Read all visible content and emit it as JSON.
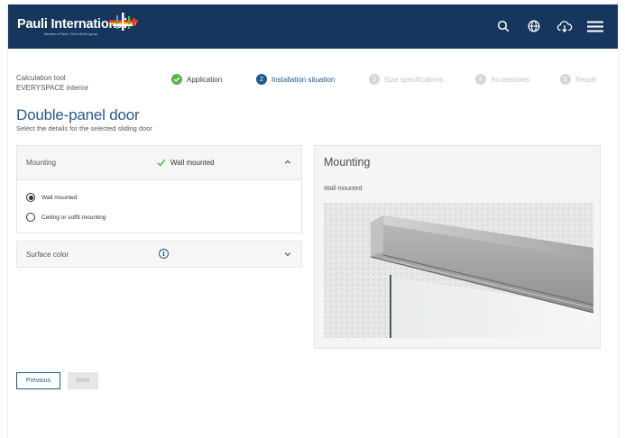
{
  "header": {
    "logo_text": "Pauli International",
    "logo_subtext": "Member of Pauli + Sohn GmbH group",
    "icons": [
      "search-icon",
      "globe-icon",
      "cloud-download-icon",
      "menu-icon"
    ]
  },
  "tool": {
    "line1": "Calculation tool",
    "line2": "EVERYSPACE interior"
  },
  "steps": [
    {
      "number": "",
      "label": "Application",
      "state": "done"
    },
    {
      "number": "2",
      "label": "Installation situation",
      "state": "active"
    },
    {
      "number": "3",
      "label": "Size specifications",
      "state": "todo"
    },
    {
      "number": "4",
      "label": "Accessories",
      "state": "todo"
    },
    {
      "number": "5",
      "label": "Result",
      "state": "todo"
    }
  ],
  "page": {
    "title": "Double-panel door",
    "subtitle": "Select the details for the selected sliding door"
  },
  "mounting": {
    "label": "Mounting",
    "selected_value": "Wall mounted",
    "options": [
      {
        "label": "Wall mounted",
        "checked": true
      },
      {
        "label": "Ceiling or soffit mounting",
        "checked": false
      }
    ]
  },
  "surface": {
    "label": "Surface color"
  },
  "preview": {
    "title": "Mounting",
    "caption": "Wall mounted"
  },
  "buttons": {
    "previous": "Previous",
    "next": "Next"
  },
  "colors": {
    "header_bg": "#17365d",
    "accent": "#1c5a8d",
    "success": "#5ab34b"
  }
}
